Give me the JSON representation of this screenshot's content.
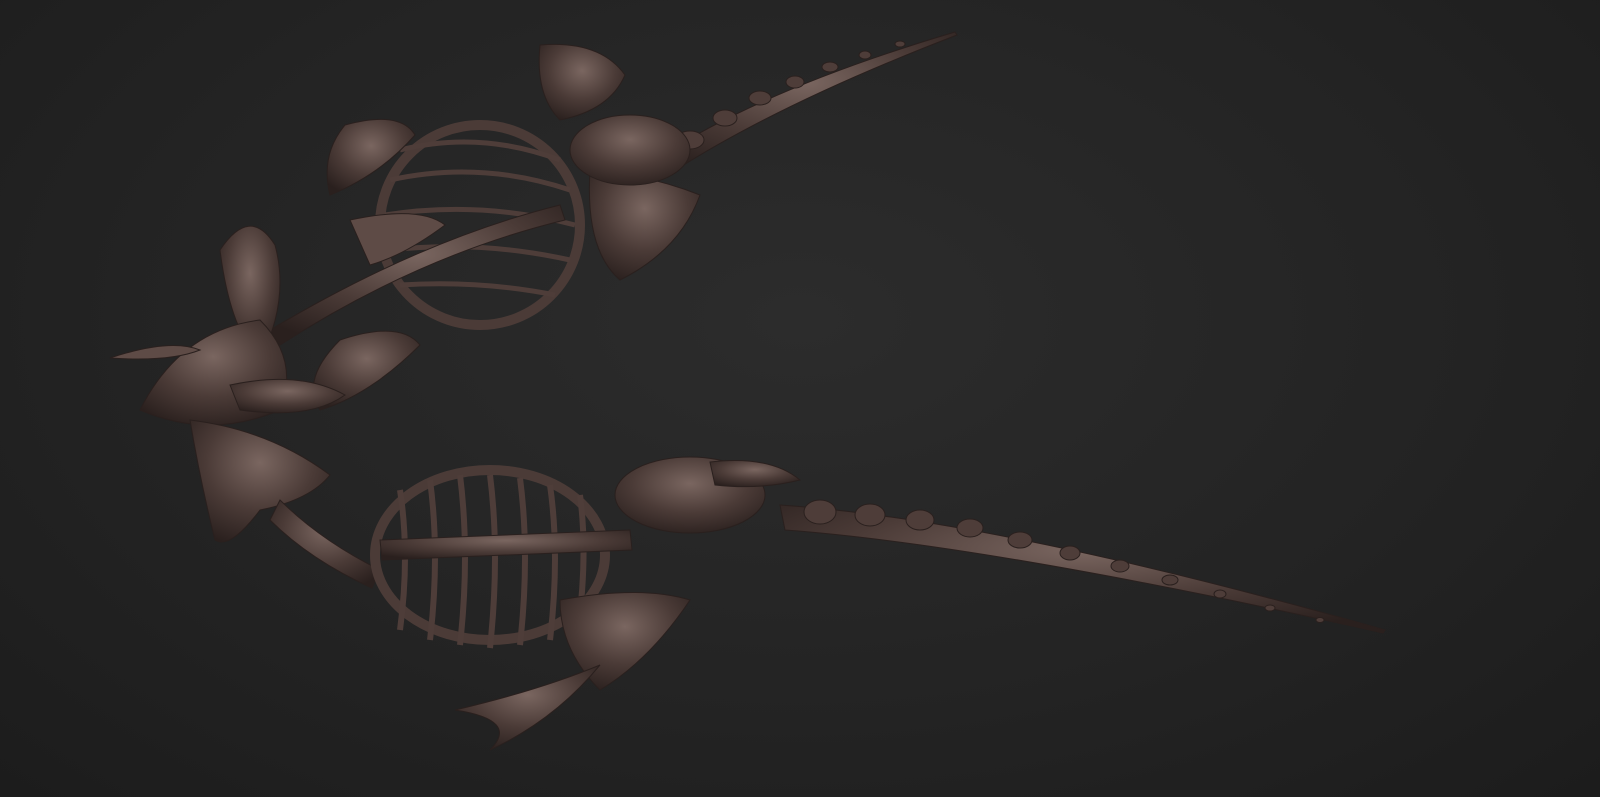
{
  "viewport": {
    "background": "#252525",
    "subject": "skeleton-render"
  },
  "colors": {
    "bone": "#4a3a36",
    "bone_light": "#6a5752",
    "bone_dark": "#2e2422"
  }
}
